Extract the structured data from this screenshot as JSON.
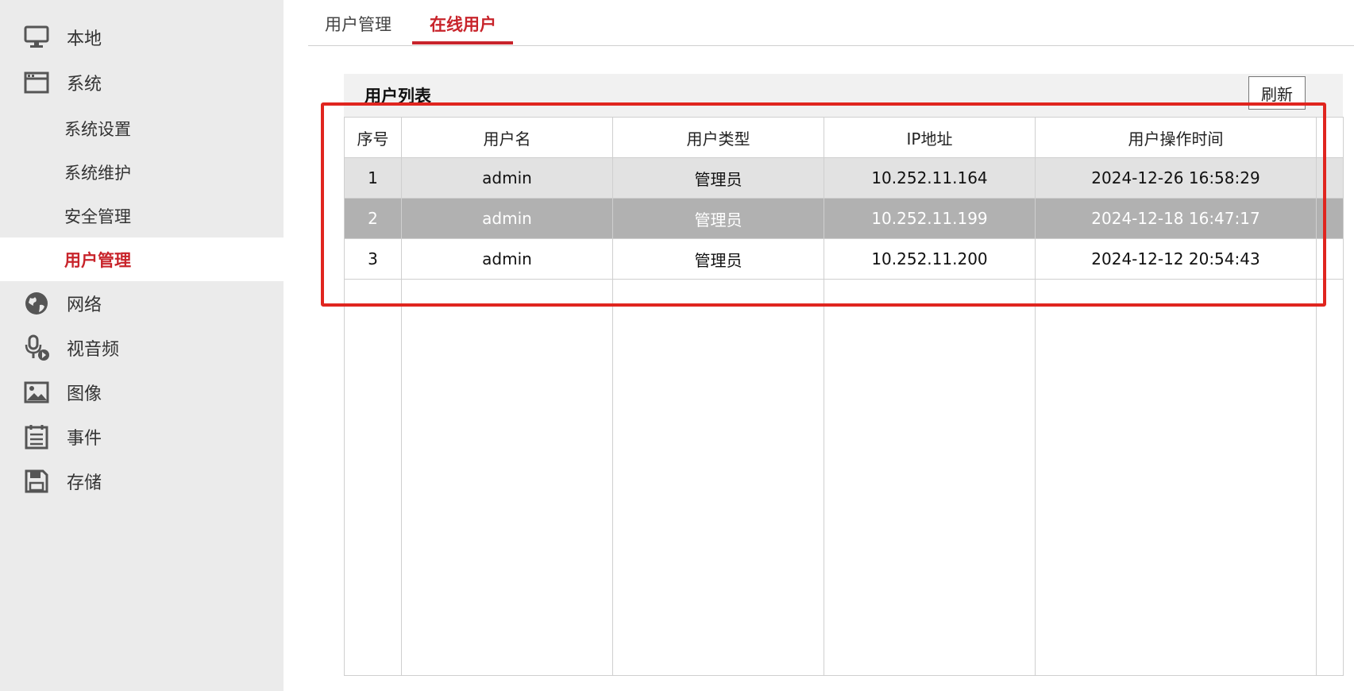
{
  "sidebar": {
    "items": [
      {
        "label": "本地",
        "icon": "monitor-icon"
      },
      {
        "label": "系统",
        "icon": "window-icon"
      }
    ],
    "sub_items": [
      {
        "label": "系统设置"
      },
      {
        "label": "系统维护"
      },
      {
        "label": "安全管理"
      },
      {
        "label": "用户管理",
        "active": true
      }
    ],
    "items_after": [
      {
        "label": "网络",
        "icon": "globe-icon"
      },
      {
        "label": "视音频",
        "icon": "microphone-icon"
      },
      {
        "label": "图像",
        "icon": "image-icon"
      },
      {
        "label": "事件",
        "icon": "event-list-icon"
      },
      {
        "label": "存储",
        "icon": "floppy-disk-icon"
      }
    ]
  },
  "tabs": [
    {
      "label": "用户管理",
      "active": false
    },
    {
      "label": "在线用户",
      "active": true
    }
  ],
  "panel": {
    "title": "用户列表",
    "refresh_label": "刷新"
  },
  "table": {
    "columns": [
      "序号",
      "用户名",
      "用户类型",
      "IP地址",
      "用户操作时间"
    ],
    "rows": [
      [
        "1",
        "admin",
        "管理员",
        "10.252.11.164",
        "2024-12-26 16:58:29"
      ],
      [
        "2",
        "admin",
        "管理员",
        "10.252.11.199",
        "2024-12-18 16:47:17"
      ],
      [
        "3",
        "admin",
        "管理员",
        "10.252.11.200",
        "2024-12-12 20:54:43"
      ]
    ]
  },
  "colors": {
    "accent": "#c8242b",
    "highlight_box": "#e0251f",
    "selected_row": "#b1b1b1"
  }
}
